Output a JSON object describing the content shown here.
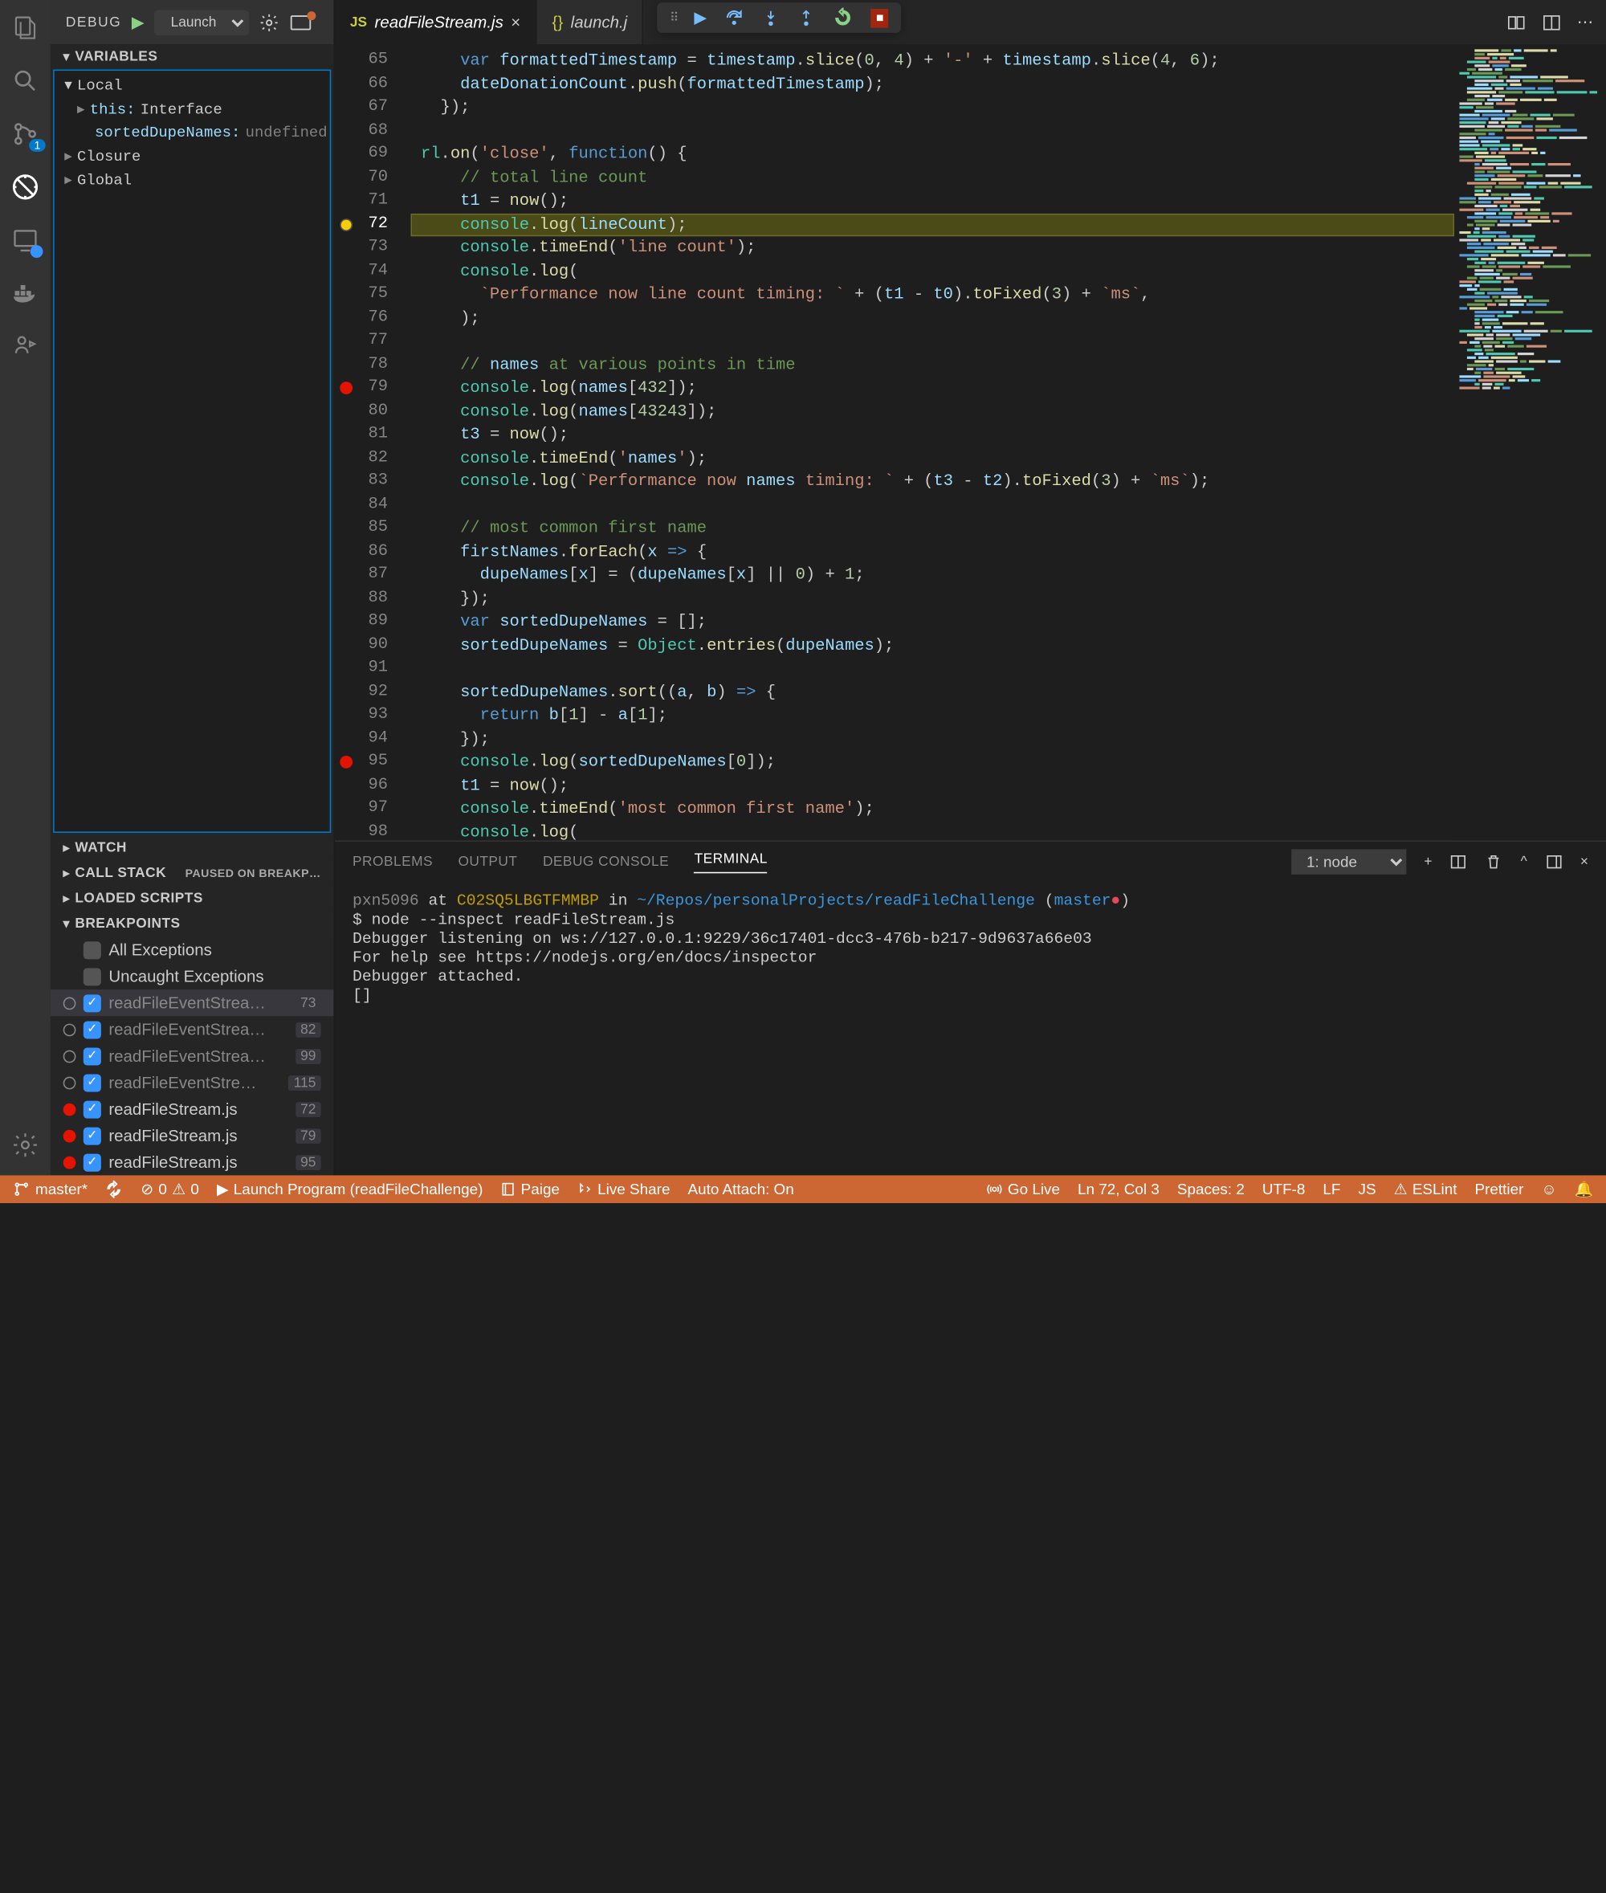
{
  "titlebar": {
    "debug_label": "DEBUG",
    "launch_label": "Launch"
  },
  "tabs": [
    {
      "icon": "JS",
      "name": "readFileStream.js",
      "active": true
    },
    {
      "icon": "{}",
      "name": "launch.j",
      "active": false
    }
  ],
  "sidebar": {
    "variables": {
      "title": "VARIABLES",
      "local": "Local",
      "this_key": "this:",
      "this_val": "Interface",
      "sdn_key": "sortedDupeNames:",
      "sdn_val": "undefined",
      "closure": "Closure",
      "global": "Global"
    },
    "watch": "WATCH",
    "callstack": {
      "title": "CALL STACK",
      "status": "PAUSED ON BREAKP…"
    },
    "loaded": "LOADED SCRIPTS",
    "breakpoints": {
      "title": "BREAKPOINTS",
      "all_exceptions": "All Exceptions",
      "uncaught": "Uncaught Exceptions",
      "items": [
        {
          "label": "readFileEventStrea…",
          "line": "73",
          "red": false,
          "active": true
        },
        {
          "label": "readFileEventStrea…",
          "line": "82",
          "red": false
        },
        {
          "label": "readFileEventStrea…",
          "line": "99",
          "red": false
        },
        {
          "label": "readFileEventStre…",
          "line": "115",
          "red": false
        },
        {
          "label": "readFileStream.js",
          "line": "72",
          "red": true
        },
        {
          "label": "readFileStream.js",
          "line": "79",
          "red": true
        },
        {
          "label": "readFileStream.js",
          "line": "95",
          "red": true
        }
      ]
    }
  },
  "editor": {
    "first_line": 65,
    "lines": [
      "    var formattedTimestamp = timestamp.slice(0, 4) + '-' + timestamp.slice(4, 6);",
      "    dateDonationCount.push(formattedTimestamp);",
      "  });",
      "",
      "rl.on('close', function() {",
      "    // total line count",
      "    t1 = now();",
      "    console.log(lineCount);",
      "    console.timeEnd('line count');",
      "    console.log(",
      "      `Performance now line count timing: ` + (t1 - t0).toFixed(3) + `ms`,",
      "    );",
      "",
      "    // names at various points in time",
      "    console.log(names[432]);",
      "    console.log(names[43243]);",
      "    t3 = now();",
      "    console.timeEnd('names');",
      "    console.log(`Performance now names timing: ` + (t3 - t2).toFixed(3) + `ms`);",
      "",
      "    // most common first name",
      "    firstNames.forEach(x => {",
      "      dupeNames[x] = (dupeNames[x] || 0) + 1;",
      "    });",
      "    var sortedDupeNames = [];",
      "    sortedDupeNames = Object.entries(dupeNames);",
      "",
      "    sortedDupeNames.sort((a, b) => {",
      "      return b[1] - a[1];",
      "    });",
      "    console.log(sortedDupeNames[0]);",
      "    t1 = now();",
      "    console.timeEnd('most common first name');",
      "    console.log("
    ],
    "breakpoint_lines": {
      "72": "current",
      "79": "red",
      "95": "red"
    },
    "highlight": 72
  },
  "panel": {
    "tabs": [
      "PROBLEMS",
      "OUTPUT",
      "DEBUG CONSOLE",
      "TERMINAL"
    ],
    "active": "TERMINAL",
    "select": "1: node",
    "terminal": {
      "l1_user": "pxn5096",
      "l1_at": " at ",
      "l1_host": "C02SQ5LBGTFMMBP",
      "l1_in": " in ",
      "l1_path": "~/Repos/personalProjects/readFileChallenge",
      "l1_branch": "master",
      "l2": "$ node --inspect readFileStream.js",
      "l3": "Debugger listening on ws://127.0.0.1:9229/36c17401-dcc3-476b-b217-9d9637a66e03",
      "l4": "For help see https://nodejs.org/en/docs/inspector",
      "l5": "Debugger attached.",
      "l6": "[]"
    }
  },
  "statusbar": {
    "branch": "master*",
    "errors": "0",
    "warnings": "0",
    "launch": "Launch Program (readFileChallenge)",
    "paige": "Paige",
    "liveshare": "Live Share",
    "autoattach": "Auto Attach: On",
    "golive": "Go Live",
    "position": "Ln 72, Col 3",
    "spaces": "Spaces: 2",
    "encoding": "UTF-8",
    "eol": "LF",
    "lang": "JS",
    "eslint": "ESLint",
    "prettier": "Prettier"
  }
}
